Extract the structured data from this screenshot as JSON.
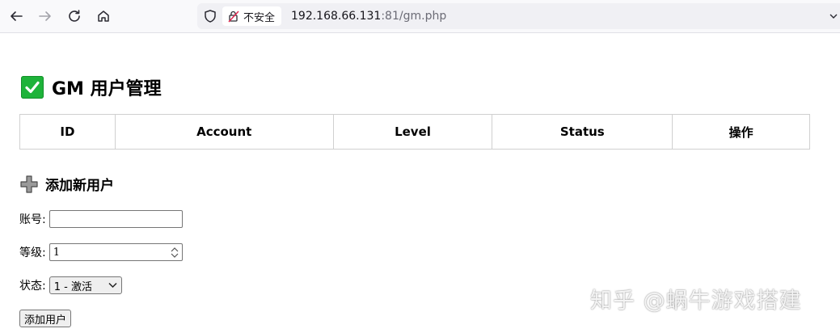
{
  "browser": {
    "security_label": "不安全",
    "url_host": "192.168.66.131",
    "url_rest": ":81/gm.php"
  },
  "page": {
    "title": "GM 用户管理",
    "table_headers": [
      "ID",
      "Account",
      "Level",
      "Status",
      "操作"
    ],
    "add_section_title": "添加新用户",
    "form": {
      "account_label": "账号:",
      "account_value": "",
      "level_label": "等级:",
      "level_value": "1",
      "status_label": "状态:",
      "status_selected": "1 - 激活",
      "submit_label": "添加用户"
    }
  },
  "watermark": "知乎 @蜗牛游戏搭建",
  "colors": {
    "check_green": "#1eb33a",
    "toolbar_bg": "#f9f9fb",
    "urlbar_bg": "#f0f0f4"
  },
  "icons": [
    "back-arrow-icon",
    "forward-arrow-icon",
    "reload-icon",
    "home-icon",
    "shield-icon",
    "insecure-lock-icon",
    "check-mark-icon",
    "plus-icon"
  ]
}
